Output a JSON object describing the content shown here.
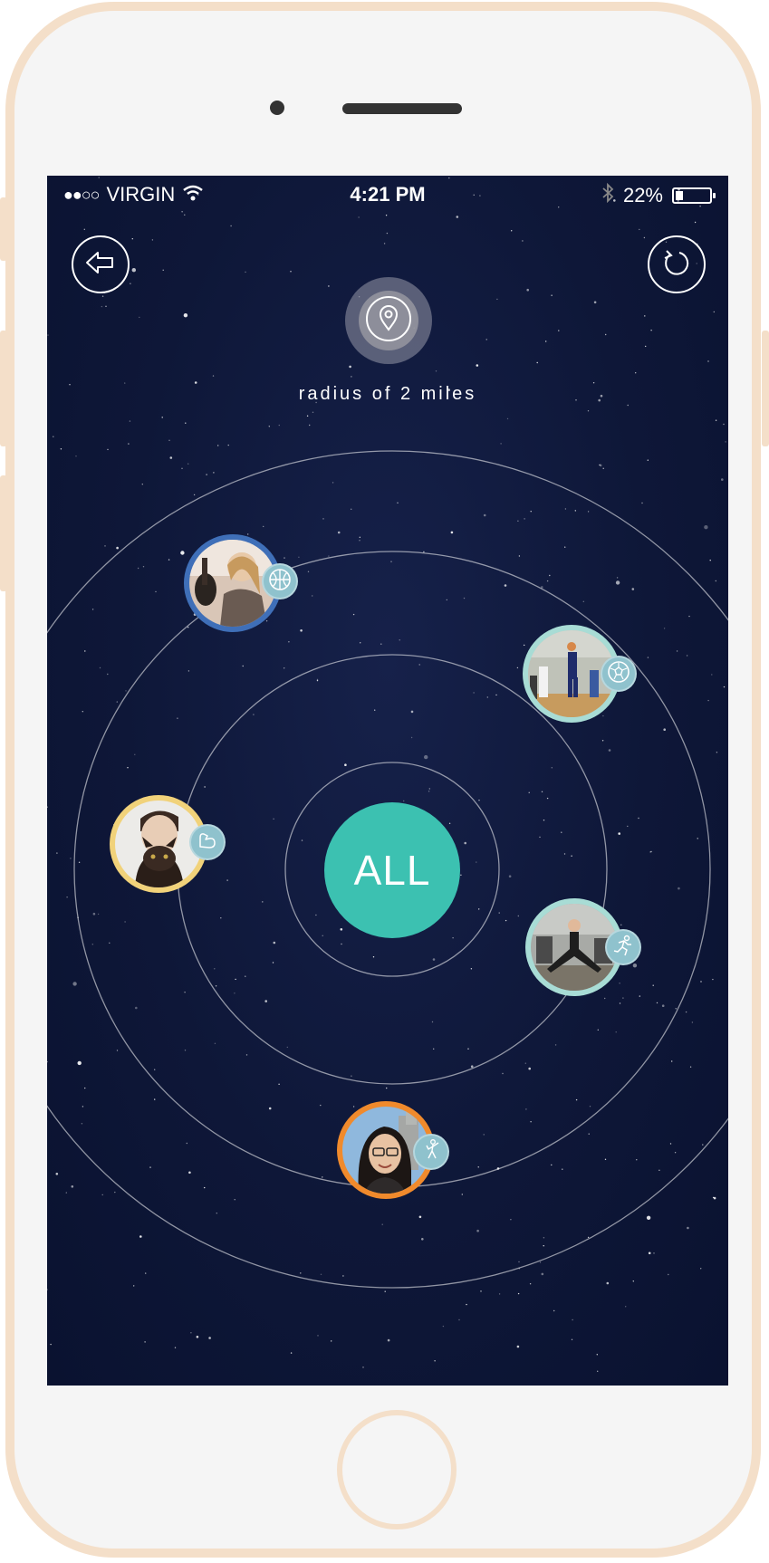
{
  "status_bar": {
    "signal": "●●○○",
    "carrier": "VIRGIN",
    "time": "4:21 PM",
    "battery_percent": "22%",
    "battery_level": 0.22
  },
  "nav": {
    "back_icon": "back-arrow-icon",
    "refresh_icon": "refresh-icon",
    "location_icon": "location-pin-icon"
  },
  "radius_label": "radius of 2 miles",
  "center_button": {
    "label": "ALL",
    "color": "#3cc1b1"
  },
  "users": [
    {
      "name": "user-guitar",
      "ring_color": "#3f6fb8",
      "activity_icon": "basketball-icon"
    },
    {
      "name": "user-basketball",
      "ring_color": "#a8dcd5",
      "activity_icon": "soccer-ball-icon"
    },
    {
      "name": "user-cat",
      "ring_color": "#f1d27a",
      "activity_icon": "muscle-icon"
    },
    {
      "name": "user-gym",
      "ring_color": "#a8dcd5",
      "activity_icon": "running-icon"
    },
    {
      "name": "user-selfie",
      "ring_color": "#f08a2c",
      "activity_icon": "dancing-icon"
    }
  ],
  "colors": {
    "background": "#0e1738",
    "phone_frame": "#f4dfc9",
    "badge": "#8fc2cd"
  }
}
